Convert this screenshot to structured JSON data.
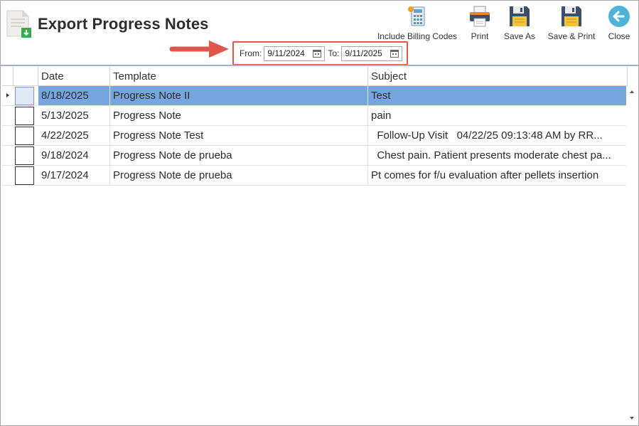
{
  "window": {
    "title": "Export Progress Notes"
  },
  "toolbar": {
    "include_billing_codes": "Include Billing Codes",
    "print": "Print",
    "save_as": "Save As",
    "save_print": "Save & Print",
    "close": "Close"
  },
  "date_filter": {
    "from_label": "From:",
    "from_value": "9/11/2024",
    "to_label": "To:",
    "to_value": "9/11/2025"
  },
  "grid": {
    "columns": [
      "Date",
      "Template",
      "Subject"
    ],
    "rows": [
      {
        "date": "8/18/2025",
        "template": "Progress Note II",
        "subject": "Test",
        "selected": true
      },
      {
        "date": "5/13/2025",
        "template": "Progress Note",
        "subject": "pain",
        "selected": false
      },
      {
        "date": "4/22/2025",
        "template": "Progress Note Test",
        "subject": "  Follow-Up Visit   04/22/25 09:13:48 AM by RR...",
        "selected": false
      },
      {
        "date": "9/18/2024",
        "template": "Progress Note de prueba",
        "subject": "  Chest pain. Patient presents moderate chest pa...",
        "selected": false
      },
      {
        "date": "9/17/2024",
        "template": "Progress Note de prueba",
        "subject": "Pt comes for f/u evaluation after pellets insertion",
        "selected": false
      }
    ]
  },
  "colors": {
    "selected_row": "#77a5e0",
    "highlight_border": "#e2554a",
    "close_button": "#4fb3d9",
    "save_icon": "#3a4f6e"
  },
  "icons": {
    "title": "document-download-icon",
    "billing": "calculator-icon",
    "print": "printer-icon",
    "save_as": "floppy-disk-icon",
    "save_print": "floppy-disk-icon",
    "close": "back-arrow-icon",
    "calendar": "calendar-icon",
    "annotation": "red-arrow-icon"
  }
}
